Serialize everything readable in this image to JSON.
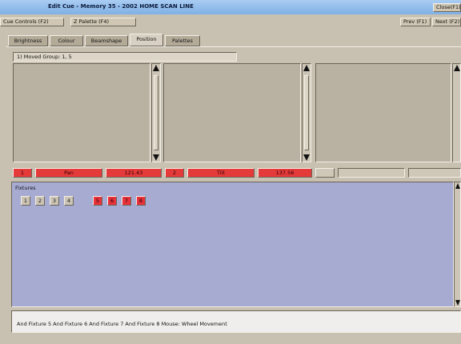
{
  "window": {
    "title": "Edit Cue - Memory 35 - 2002 HOME SCAN LINE",
    "close_label": "Close(F1)"
  },
  "toolbar": {
    "cue_controls_label": "Cue Controls (F2)",
    "palettes_label": "Z Palette (F4)",
    "prev_label": "Prev (F1)",
    "next_label": "Next (F2)"
  },
  "tabs": [
    {
      "label": "Brightness"
    },
    {
      "label": "Colour"
    },
    {
      "label": "Beamshape"
    },
    {
      "label": "Position"
    },
    {
      "label": "Palettes"
    }
  ],
  "group_dropdown": {
    "value": "1) Moved Group: 1, 5"
  },
  "param_rows": {
    "left": {
      "index": "1",
      "name": "Pan",
      "value": "121.43"
    },
    "right": {
      "index": "2",
      "name": "Tilt",
      "value": "137.56"
    }
  },
  "fixtures": {
    "label": "Fixtures",
    "items": [
      {
        "number": "1",
        "state": "grey"
      },
      {
        "number": "2",
        "state": "grey"
      },
      {
        "number": "3",
        "state": "grey"
      },
      {
        "number": "4",
        "state": "grey"
      },
      {
        "number": "5",
        "state": "red"
      },
      {
        "number": "6",
        "state": "red"
      },
      {
        "number": "7",
        "state": "red"
      },
      {
        "number": "8",
        "state": "red"
      }
    ]
  },
  "command_line": {
    "text": "And Fixture 5 And Fixture 6 And Fixture 7 And Fixture 8 Mouse: Wheel Movement"
  },
  "colors": {
    "title_bar": "#8fbcec",
    "selected": "#e53a3a",
    "fixture_area": "#a7abd2",
    "panel": "#b9b1a2"
  }
}
